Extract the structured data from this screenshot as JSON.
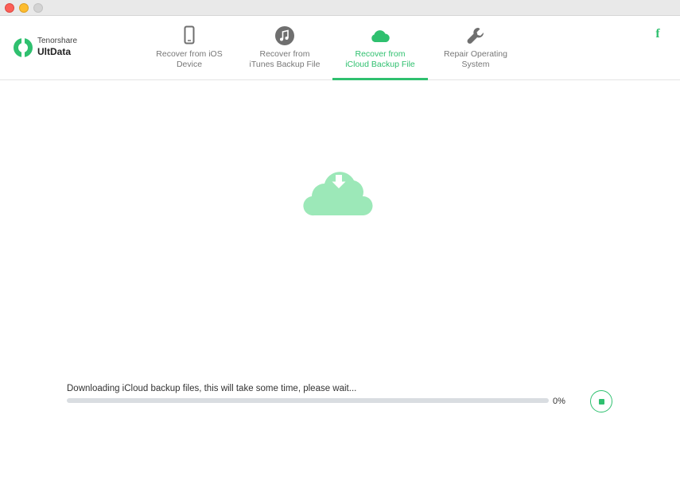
{
  "brand": {
    "company": "Tenorshare",
    "product": "UltData"
  },
  "tabs": [
    {
      "label": "Recover from iOS\nDevice",
      "icon": "phone-icon",
      "active": false
    },
    {
      "label": "Recover from\niTunes Backup File",
      "icon": "music-note-icon",
      "active": false
    },
    {
      "label": "Recover from\niCloud Backup File",
      "icon": "cloud-icon",
      "active": true
    },
    {
      "label": "Repair Operating\nSystem",
      "icon": "wrench-icon",
      "active": false
    }
  ],
  "social": {
    "facebook_label": "f"
  },
  "download": {
    "status_text": "Downloading iCloud backup files, this will take some time, please wait...",
    "percent_text": "0%",
    "progress": 0
  },
  "colors": {
    "accent": "#2fc06f",
    "cloud": "#9ce8b8",
    "track": "#d9dde1"
  }
}
